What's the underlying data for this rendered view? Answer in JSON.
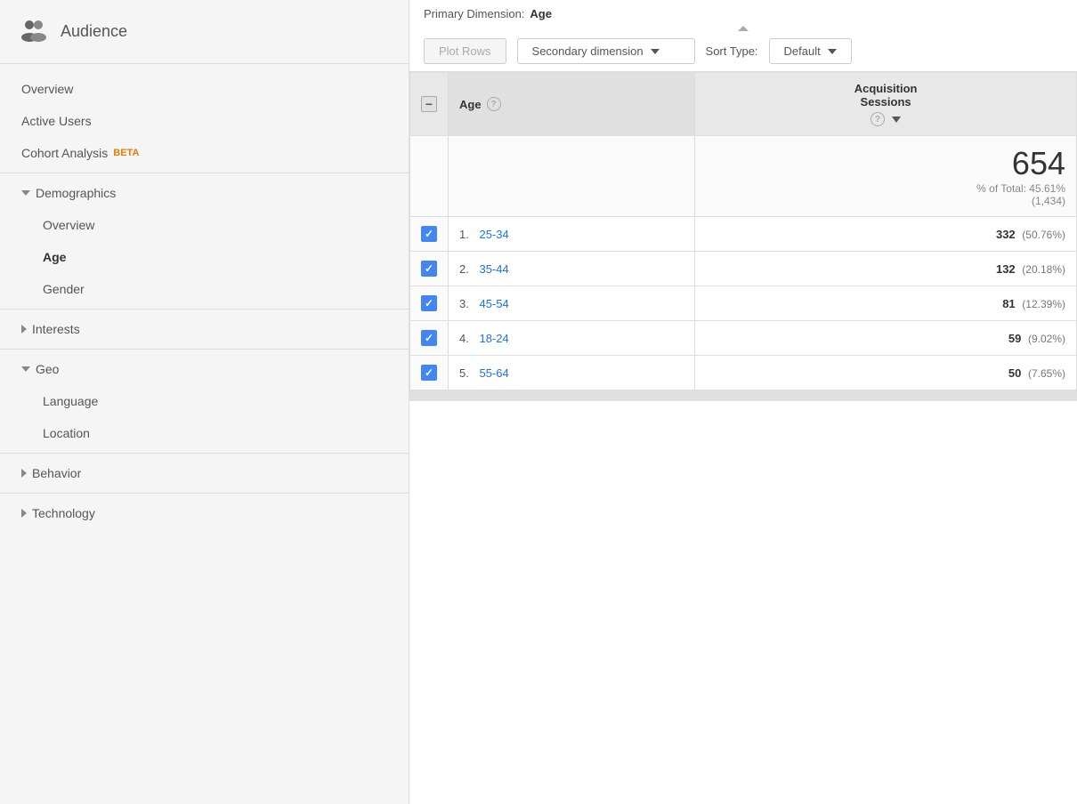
{
  "sidebar": {
    "header": {
      "title": "Audience",
      "icon": "audience-icon"
    },
    "items": [
      {
        "id": "overview",
        "label": "Overview",
        "type": "item",
        "indent": 0
      },
      {
        "id": "active-users",
        "label": "Active Users",
        "type": "item",
        "indent": 0
      },
      {
        "id": "cohort-analysis",
        "label": "Cohort Analysis",
        "type": "item-beta",
        "indent": 0,
        "beta": "BETA"
      },
      {
        "id": "demographics",
        "label": "Demographics",
        "type": "section-expanded",
        "indent": 0
      },
      {
        "id": "demo-overview",
        "label": "Overview",
        "type": "item",
        "indent": 1
      },
      {
        "id": "age",
        "label": "Age",
        "type": "item-active",
        "indent": 1
      },
      {
        "id": "gender",
        "label": "Gender",
        "type": "item",
        "indent": 1
      },
      {
        "id": "interests",
        "label": "Interests",
        "type": "section-collapsed",
        "indent": 0
      },
      {
        "id": "geo",
        "label": "Geo",
        "type": "section-expanded",
        "indent": 0
      },
      {
        "id": "language",
        "label": "Language",
        "type": "item",
        "indent": 1
      },
      {
        "id": "location",
        "label": "Location",
        "type": "item",
        "indent": 1
      },
      {
        "id": "behavior",
        "label": "Behavior",
        "type": "section-collapsed",
        "indent": 0
      },
      {
        "id": "technology",
        "label": "Technology",
        "type": "section-collapsed",
        "indent": 0
      }
    ]
  },
  "topbar": {
    "primary_dim_label": "Primary Dimension:",
    "primary_dim_value": "Age",
    "plot_rows_label": "Plot Rows",
    "secondary_dim_label": "Secondary dimension",
    "sort_type_label": "Sort Type:",
    "sort_default_label": "Default"
  },
  "table": {
    "header_age": "Age",
    "header_help_tooltip": "?",
    "header_acquisition": "Acquisition",
    "header_sessions": "Sessions",
    "summary": {
      "sessions": "654",
      "pct_of_total": "% of Total:",
      "pct_value": "45.61%",
      "total": "(1,434)"
    },
    "rows": [
      {
        "num": "1.",
        "age": "25-34",
        "sessions": "332",
        "pct": "(50.76%)"
      },
      {
        "num": "2.",
        "age": "35-44",
        "sessions": "132",
        "pct": "(20.18%)"
      },
      {
        "num": "3.",
        "age": "45-54",
        "sessions": "81",
        "pct": "(12.39%)"
      },
      {
        "num": "4.",
        "age": "18-24",
        "sessions": "59",
        "pct": "(9.02%)"
      },
      {
        "num": "5.",
        "age": "55-64",
        "sessions": "50",
        "pct": "(7.65%)"
      }
    ]
  }
}
